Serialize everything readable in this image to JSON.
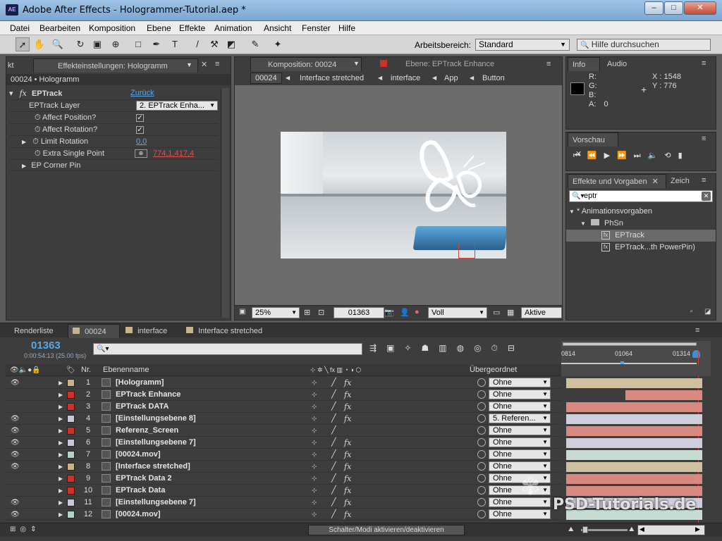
{
  "window": {
    "title": "Adobe After Effects - Hologrammer-Tutorial.aep *",
    "app_badge": "AE",
    "buttons": [
      "–",
      "□",
      "✕"
    ]
  },
  "menu": [
    "Datei",
    "Bearbeiten",
    "Komposition",
    "Ebene",
    "Effekte",
    "Animation",
    "Ansicht",
    "Fenster",
    "Hilfe"
  ],
  "toolbar": {
    "workspace_label": "Arbeitsbereich:",
    "workspace_value": "Standard",
    "help_placeholder": "Hilfe durchsuchen"
  },
  "effects_panel": {
    "left_tab": "kt",
    "tab": "Effekteinstellungen: Hologramm",
    "breadcrumb": "00024 • Hologramm",
    "effect_name": "EPTrack",
    "reset": "Zurück",
    "rows": [
      {
        "label": "EPTrack Layer",
        "value": "2. EPTrack Enha..."
      },
      {
        "label": "Affect Position?",
        "checked": true
      },
      {
        "label": "Affect Rotation?",
        "checked": true
      },
      {
        "label": "Limit Rotation",
        "value": "0,0"
      },
      {
        "label": "Extra Single Point",
        "value": "774,1,417,4"
      },
      {
        "label": "EP Corner Pin"
      }
    ]
  },
  "comp_panel": {
    "tab_comp": "Komposition: 00024",
    "tab_layer": "Ebene: EPTrack Enhance",
    "crumbs": [
      "00024",
      "Interface stretched",
      "interface",
      "App",
      "Button"
    ],
    "zoom": "25%",
    "timecode": "01363",
    "resolution": "Voll",
    "camera": "Aktive Kar"
  },
  "info_panel": {
    "tabs": [
      "Info",
      "Audio"
    ],
    "r": "R:",
    "g": "G:",
    "b": "B:",
    "a": "A:",
    "a_val": "0",
    "x": "X : 1548",
    "y": "Y : 776"
  },
  "preview_panel": {
    "tab": "Vorschau"
  },
  "presets_panel": {
    "tabs": [
      "Effekte und Vorgaben",
      "Zeich"
    ],
    "search": "eptr",
    "tree": [
      {
        "label": "* Animationsvorgaben",
        "level": 0
      },
      {
        "label": "PhSn",
        "level": 1
      },
      {
        "label": "EPTrack",
        "level": 2,
        "selected": true
      },
      {
        "label": "EPTrack...th PowerPin)",
        "level": 2
      }
    ]
  },
  "timeline": {
    "tabs": [
      "Renderliste",
      "00024",
      "interface",
      "Interface stretched"
    ],
    "timecode": "01363",
    "subtime": "0:00:54:13 (25.00 fps)",
    "col_nr": "Nr.",
    "col_name": "Ebenenname",
    "col_parent": "Übergeordnet",
    "ruler": [
      "0814",
      "01064",
      "01314"
    ],
    "footer": "Schalter/Modi aktivieren/deaktivieren",
    "layers": [
      {
        "nr": "1",
        "name": "[Hologramm]",
        "color": "#c8b48a",
        "parent": "Ohne",
        "eye": true,
        "fx": true,
        "bar": "#cfc0a0",
        "barstart": 0
      },
      {
        "nr": "2",
        "name": "EPTrack Enhance",
        "color": "#d0302a",
        "parent": "Ohne",
        "eye": false,
        "fx": true,
        "bar": "#d98a80",
        "barstart": 84
      },
      {
        "nr": "3",
        "name": "EPTrack DATA",
        "color": "#d0302a",
        "parent": "Ohne",
        "eye": false,
        "fx": true,
        "bar": "#d98a80",
        "barstart": 0
      },
      {
        "nr": "4",
        "name": "[Einstellungsebene 8]",
        "color": "#c8c8d8",
        "parent": "5. Referen...",
        "eye": true,
        "fx": true,
        "bar": "#cfcfdb",
        "barstart": 0
      },
      {
        "nr": "5",
        "name": "Referenz_Screen",
        "color": "#d0302a",
        "parent": "Ohne",
        "eye": true,
        "fx": false,
        "bar": "#d98a80",
        "barstart": 0
      },
      {
        "nr": "6",
        "name": "[Einstellungsebene 7]",
        "color": "#c8c8d8",
        "parent": "Ohne",
        "eye": true,
        "fx": true,
        "bar": "#cfcfdb",
        "barstart": 0
      },
      {
        "nr": "7",
        "name": "[00024.mov]",
        "color": "#b5d3c5",
        "parent": "Ohne",
        "eye": true,
        "fx": true,
        "bar": "#c7ddd3",
        "barstart": 0
      },
      {
        "nr": "8",
        "name": "[Interface stretched]",
        "color": "#c8b48a",
        "parent": "Ohne",
        "eye": true,
        "fx": true,
        "bar": "#cfc0a0",
        "barstart": 0
      },
      {
        "nr": "9",
        "name": "EPTrack Data 2",
        "color": "#d0302a",
        "parent": "Ohne",
        "eye": false,
        "fx": true,
        "bar": "#d98a80",
        "barstart": 0
      },
      {
        "nr": "10",
        "name": "EPTrack Data",
        "color": "#d0302a",
        "parent": "Ohne",
        "eye": false,
        "fx": true,
        "bar": "#d98a80",
        "barstart": 0
      },
      {
        "nr": "11",
        "name": "[Einstellungsebene 7]",
        "color": "#c8c8d8",
        "parent": "Ohne",
        "eye": true,
        "fx": true,
        "bar": "#cfcfdb",
        "barstart": 0
      },
      {
        "nr": "12",
        "name": "[00024.mov]",
        "color": "#b5d3c5",
        "parent": "Ohne",
        "eye": true,
        "fx": true,
        "bar": "#c7ddd3",
        "barstart": 0
      }
    ]
  },
  "watermark": "PSD-Tutorials.de"
}
